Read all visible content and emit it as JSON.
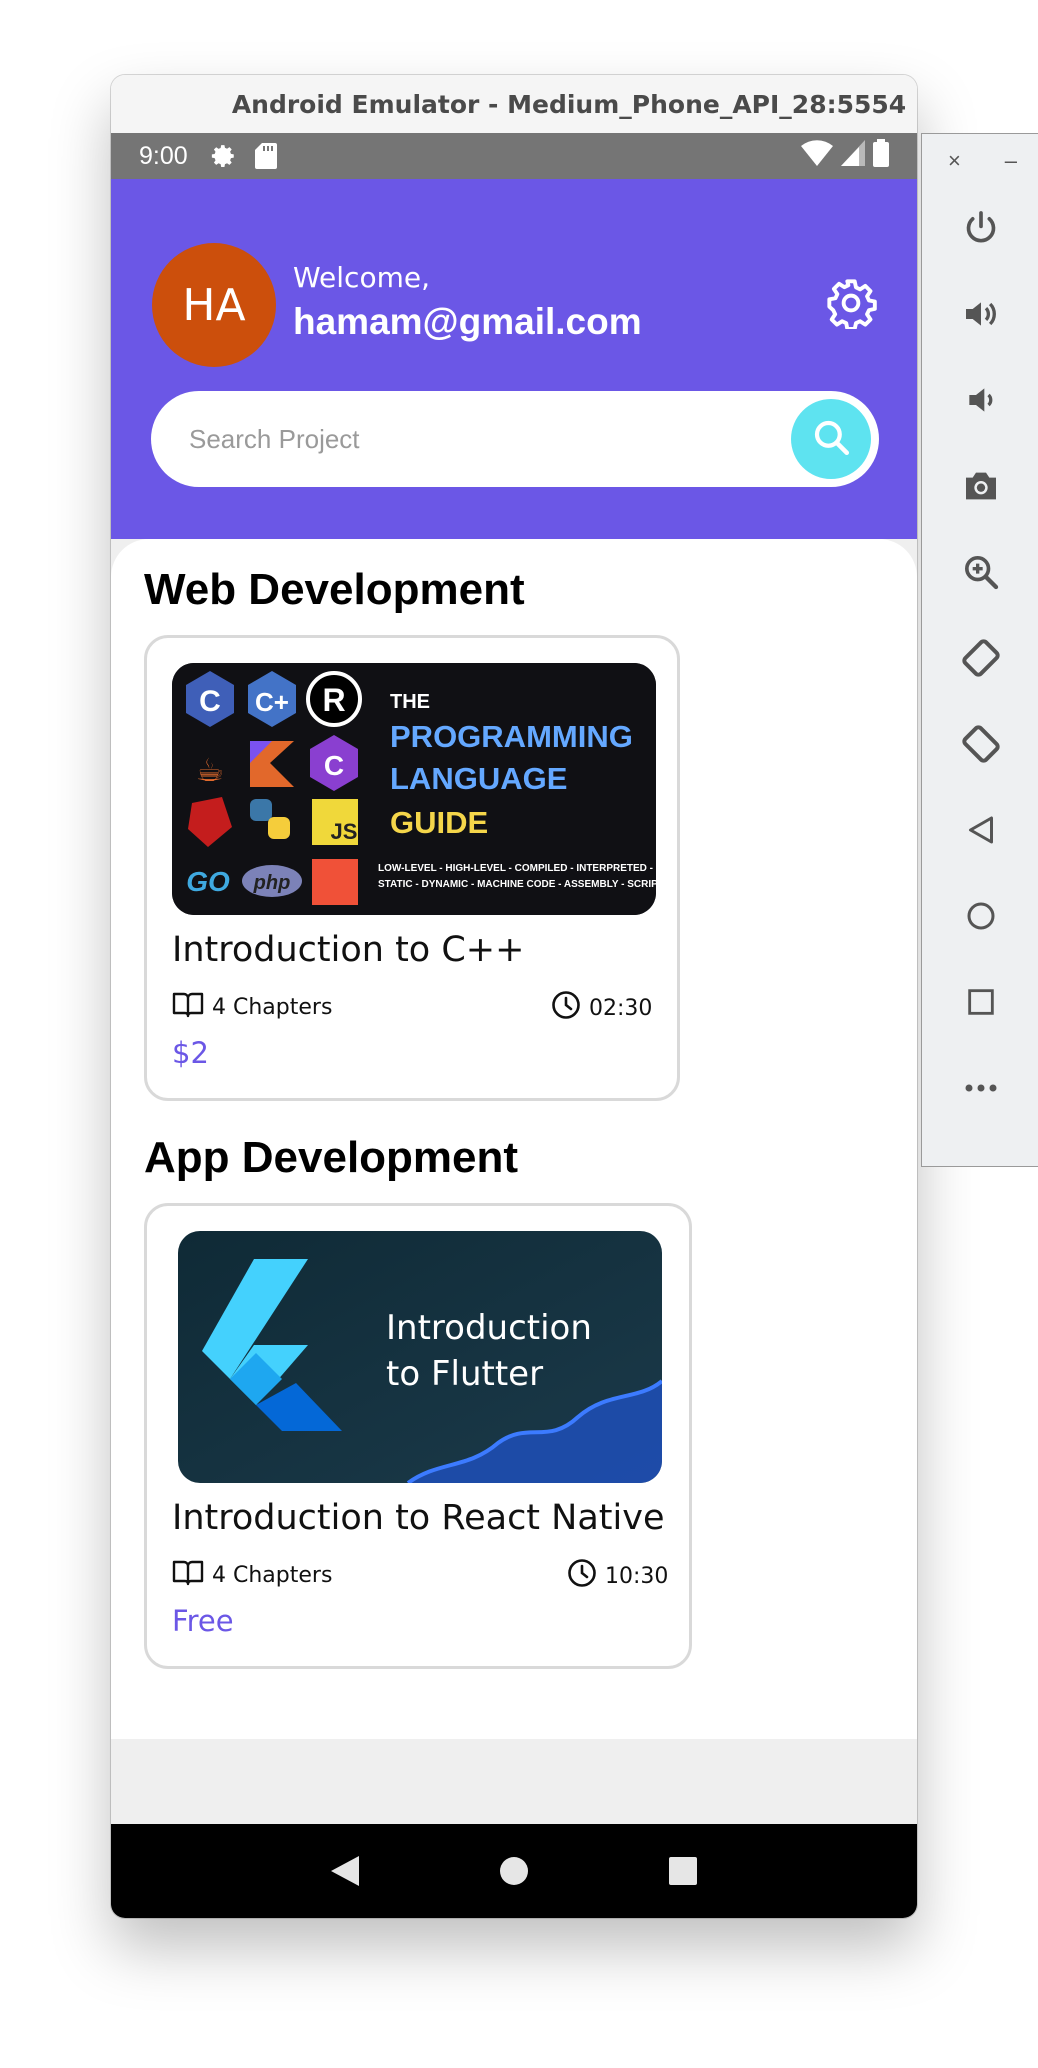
{
  "emulator": {
    "title": "Android Emulator - Medium_Phone_API_28:5554",
    "close_label": "×",
    "minimize_label": "–"
  },
  "statusbar": {
    "time": "9:00"
  },
  "header": {
    "avatar_initials": "HA",
    "welcome": "Welcome,",
    "email": "hamam@gmail.com"
  },
  "search": {
    "placeholder": "Search Project"
  },
  "sections": [
    {
      "title": "Web Development",
      "course": {
        "thumb_lines": [
          "THE",
          "PROGRAMMING",
          "LANGUAGE",
          "GUIDE"
        ],
        "thumb_footer": [
          "LOW-LEVEL - HIGH-LEVEL - COMPILED - INTERPRETED - OOP",
          "STATIC - DYNAMIC - MACHINE CODE - ASSEMBLY - SCRIPTING"
        ],
        "title": "Introduction to C++",
        "chapters": "4 Chapters",
        "duration": "02:30",
        "price": "$2"
      }
    },
    {
      "title": "App Development",
      "course": {
        "thumb_lines": [
          "Introduction",
          "to Flutter"
        ],
        "title": "Introduction to React Native",
        "chapters": "4 Chapters",
        "duration": "10:30",
        "price": "Free"
      }
    }
  ],
  "colors": {
    "primary": "#6b57e6",
    "avatar": "#cc4f0c",
    "search_button": "#5ee3f0"
  }
}
